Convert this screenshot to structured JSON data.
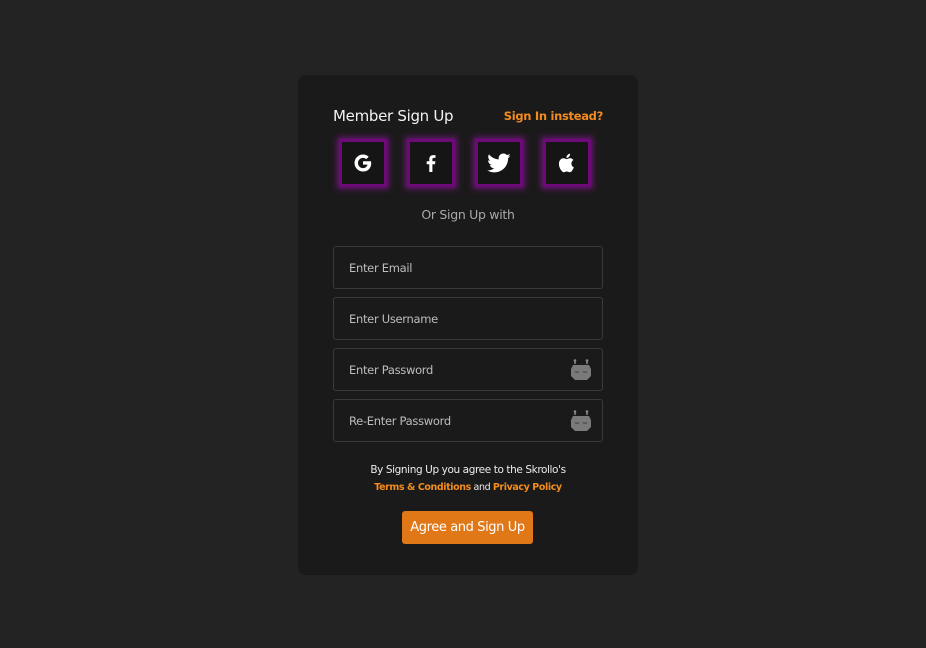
{
  "header": {
    "title": "Member Sign Up",
    "signin_link": "Sign In instead?"
  },
  "social": {
    "buttons": [
      {
        "icon": "google-icon"
      },
      {
        "icon": "facebook-icon"
      },
      {
        "icon": "twitter-icon"
      },
      {
        "icon": "apple-icon"
      }
    ],
    "separator": "Or Sign Up with"
  },
  "form": {
    "email": {
      "placeholder": "Enter Email",
      "value": ""
    },
    "username": {
      "placeholder": "Enter Username",
      "value": ""
    },
    "password": {
      "placeholder": "Enter Password",
      "value": "",
      "toggle_icon": "robot-eyes-closed-icon"
    },
    "confirm_password": {
      "placeholder": "Re-Enter Password",
      "value": "",
      "toggle_icon": "robot-eyes-closed-icon"
    }
  },
  "terms": {
    "prefix": "By Signing Up you agree to the Skrollo's",
    "terms_link": "Terms & Conditions",
    "conjunction": "and",
    "privacy_link": "Privacy Policy"
  },
  "submit_label": "Agree and Sign Up",
  "colors": {
    "page_background": "#232323",
    "card_background": "#1b1a1a",
    "accent": "#f28c1f",
    "button": "#e07818",
    "social_border": "#6e0a78"
  }
}
